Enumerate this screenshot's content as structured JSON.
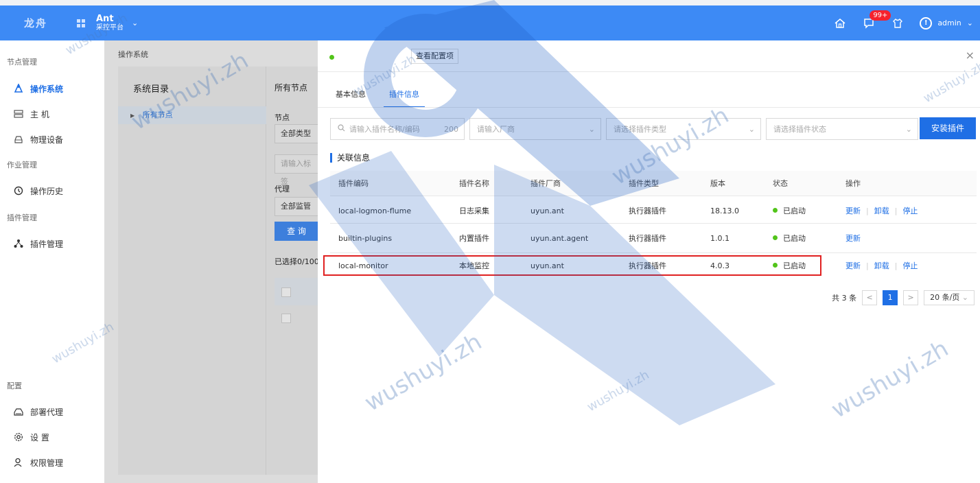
{
  "topbar": {
    "logo": "龙舟",
    "brand_name": "Ant",
    "brand_sub": "采控平台",
    "badge": "99+",
    "user": "admin"
  },
  "sidebar": {
    "groups": [
      "节点管理",
      "作业管理",
      "插件管理",
      "配置"
    ],
    "items": [
      {
        "label": "操作系统",
        "icon": "os-icon",
        "active": true
      },
      {
        "label": "主 机",
        "icon": "host-icon"
      },
      {
        "label": "物理设备",
        "icon": "device-icon"
      },
      {
        "label": "操作历史",
        "icon": "history-icon"
      },
      {
        "label": "插件管理",
        "icon": "plugin-icon"
      },
      {
        "label": "部署代理",
        "icon": "deploy-icon"
      },
      {
        "label": "设 置",
        "icon": "settings-icon"
      },
      {
        "label": "权限管理",
        "icon": "user-icon"
      }
    ]
  },
  "main": {
    "breadcrumb": "操作系统",
    "tree_title": "系统目录",
    "tree_root": "所有节点",
    "nodes_title": "所有节点",
    "node_label": "节点",
    "node_type": "全部类型",
    "search_ph": "请输入标签",
    "agent_label": "代理",
    "agent_value": "全部监管",
    "query_btn": "查 询",
    "selected": "已选择0/100"
  },
  "drawer": {
    "view_config": "查看配置项",
    "tabs": [
      "基本信息",
      "插件信息"
    ],
    "filters": {
      "name_ph": "请输入插件名称/编码",
      "name_count": "200",
      "vendor_ph": "请输入厂商",
      "type_ph": "请选择插件类型",
      "status_ph": "请选择插件状态"
    },
    "install_btn": "安装插件",
    "section": "关联信息",
    "columns": [
      "插件编码",
      "插件名称",
      "插件厂商",
      "插件类型",
      "版本",
      "状态",
      "操作"
    ],
    "rows": [
      {
        "code": "local-logmon-flume",
        "name": "日志采集",
        "vendor": "uyun.ant",
        "type": "执行器插件",
        "version": "18.13.0",
        "status": "已启动",
        "ops": [
          "更新",
          "卸载",
          "停止"
        ]
      },
      {
        "code": "builtin-plugins",
        "name": "内置插件",
        "vendor": "uyun.ant.agent",
        "type": "执行器插件",
        "version": "1.0.1",
        "status": "已启动",
        "ops": [
          "更新"
        ]
      },
      {
        "code": "local-monitor",
        "name": "本地监控",
        "vendor": "uyun.ant",
        "type": "执行器插件",
        "version": "4.0.3",
        "status": "已启动",
        "ops": [
          "更新",
          "卸载",
          "停止"
        ]
      }
    ],
    "pager": {
      "total": "共 3 条",
      "page": "1",
      "size": "20 条/页"
    }
  },
  "watermark": "wushuyi.zh",
  "colors": {
    "primary": "#1f6fe5",
    "topbar": "#3d8af5",
    "success": "#52c41a",
    "highlight": "#e02020"
  }
}
